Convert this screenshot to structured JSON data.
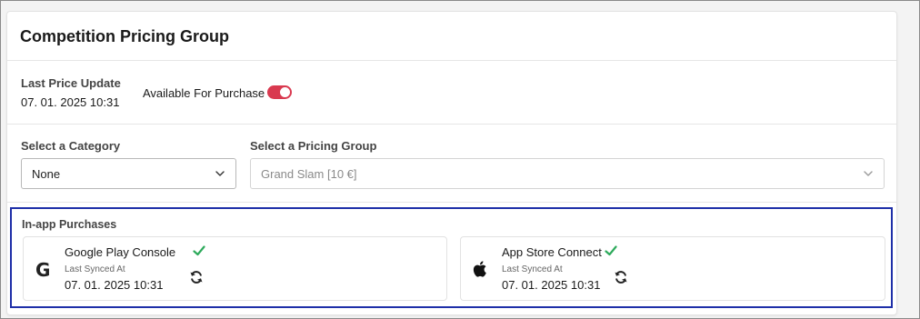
{
  "card": {
    "title": "Competition Pricing Group"
  },
  "info": {
    "last_price_update_label": "Last Price Update",
    "last_price_update_value": "07. 01. 2025 10:31",
    "available_label": "Available For Purchase",
    "available_on": true
  },
  "selects": {
    "category_label": "Select a Category",
    "category_value": "None",
    "pricing_group_label": "Select a Pricing Group",
    "pricing_group_value": "Grand Slam [10 €]"
  },
  "iap": {
    "title": "In-app Purchases",
    "stores": [
      {
        "name": "Google Play Console",
        "icon": "google-icon",
        "synced_label": "Last Synced At",
        "synced_value": "07. 01. 2025 10:31"
      },
      {
        "name": "App Store Connect",
        "icon": "apple-icon",
        "synced_label": "Last Synced At",
        "synced_value": "07. 01. 2025 10:31"
      }
    ]
  },
  "colors": {
    "toggle_on": "#d9394f",
    "check_green": "#2eaa5c",
    "highlight_border": "#1e2fa8"
  }
}
